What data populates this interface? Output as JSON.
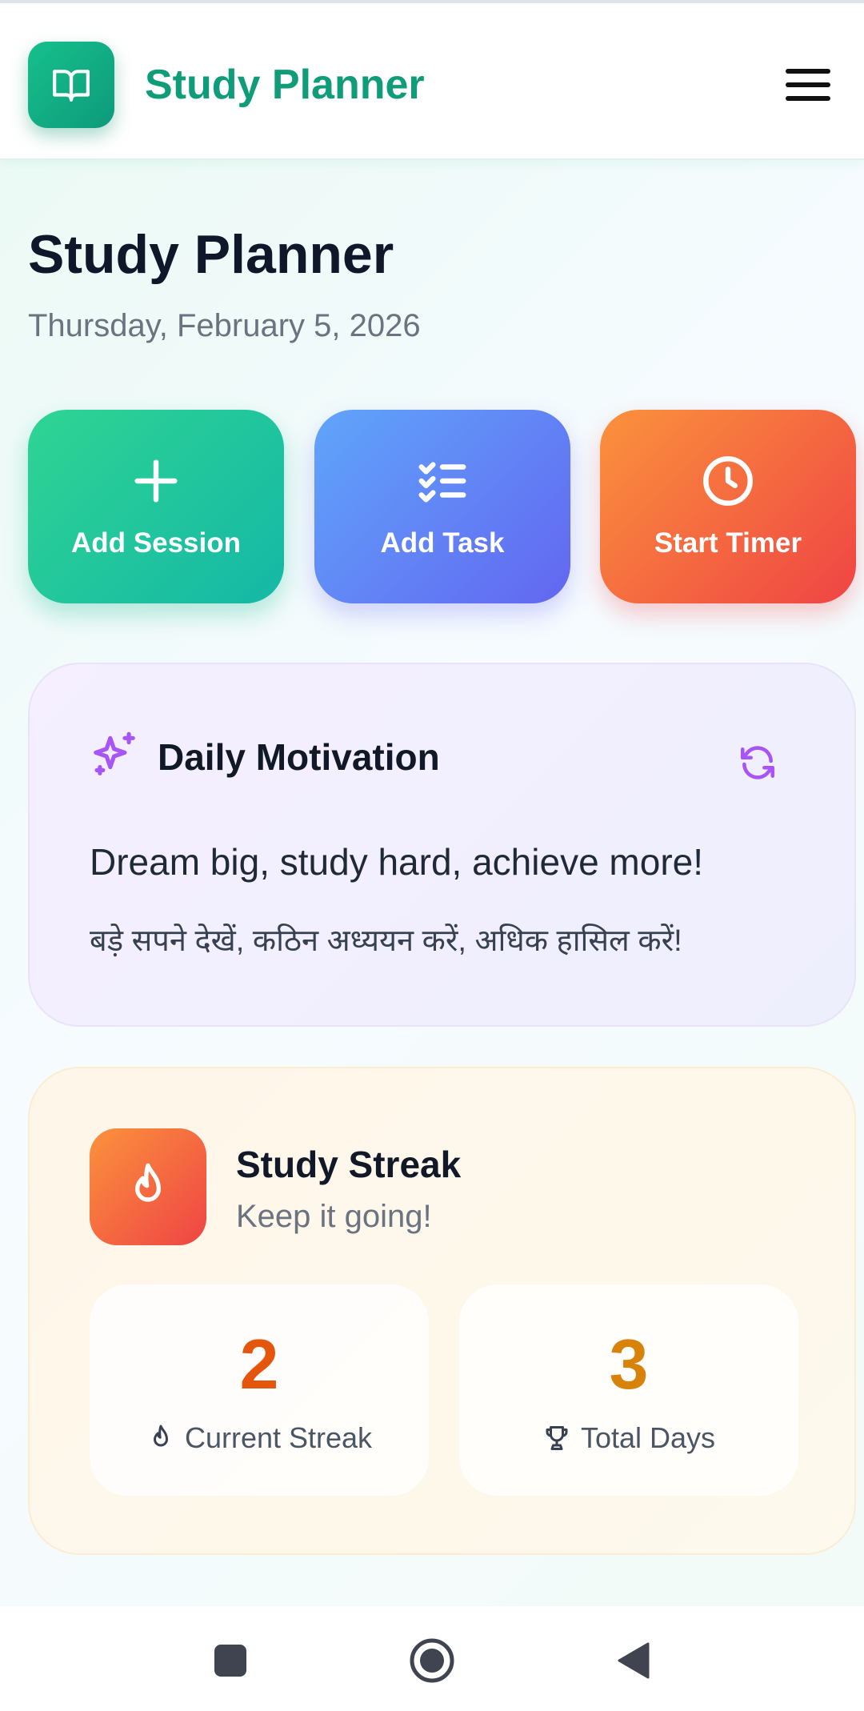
{
  "header": {
    "app_name": "Study Planner",
    "logo_icon": "open-book-icon",
    "menu_icon": "hamburger-menu-icon"
  },
  "page": {
    "title": "Study Planner",
    "date": "Thursday, February 5, 2026"
  },
  "actions": [
    {
      "label": "Add Session",
      "icon": "plus-icon",
      "color": "#22c493"
    },
    {
      "label": "Add Task",
      "icon": "checklist-icon",
      "color": "#6d82f7"
    },
    {
      "label": "Start Timer",
      "icon": "clock-icon",
      "color": "#f76b3c"
    }
  ],
  "motivation": {
    "title": "Daily Motivation",
    "icon": "sparkles-icon",
    "refresh_icon": "refresh-icon",
    "quote_en": "Dream big, study hard, achieve more!",
    "quote_hi": "बड़े सपने देखें, कठिन अध्ययन करें, अधिक हासिल करें!",
    "accent": "#a855f7"
  },
  "streak": {
    "title": "Study Streak",
    "subtitle": "Keep it going!",
    "icon": "flame-icon",
    "stats": [
      {
        "value": "2",
        "label": "Current Streak",
        "icon": "flame-icon",
        "color": "#e4560d"
      },
      {
        "value": "3",
        "label": "Total Days",
        "icon": "trophy-icon",
        "color": "#d9820a"
      }
    ]
  },
  "system_nav": {
    "buttons": [
      "recents-square-icon",
      "home-circle-icon",
      "back-triangle-icon"
    ]
  },
  "colors": {
    "brand": "#0f9c78",
    "text_dark": "#0f172a",
    "text_muted": "#6b7280"
  }
}
